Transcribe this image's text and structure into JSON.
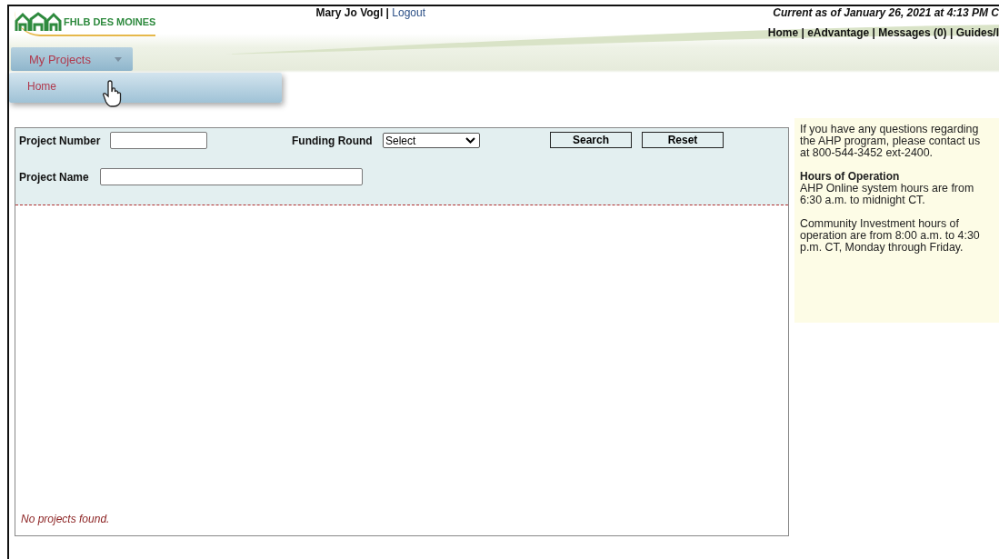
{
  "header": {
    "logo": "FHLB DES MOINES",
    "user": "Mary Jo Vogl",
    "separator": "|",
    "logout": "Logout",
    "current_as_of": "Current as of January 26, 2021 at 4:13 PM C",
    "nav": [
      {
        "label": "Home"
      },
      {
        "label": "eAdvantage"
      },
      {
        "label": "Messages (0)"
      },
      {
        "label": "Guides/I"
      }
    ]
  },
  "menu": {
    "label": "My Projects",
    "expanded": true,
    "items": [
      {
        "label": "Home"
      }
    ]
  },
  "search": {
    "fields": [
      {
        "kind": "text",
        "label": "Project Number"
      },
      {
        "kind": "select",
        "label": "Funding Round",
        "value": "Select"
      },
      {
        "kind": "text",
        "label": "Project Name"
      }
    ],
    "buttons": [
      {
        "label": "Search"
      },
      {
        "label": "Reset"
      }
    ]
  },
  "results": {
    "message": "No projects found."
  },
  "help": {
    "intro": "If you have any questions regarding the AHP program, please contact us at 800-544-3452 ext-2400.",
    "heading": "Hours of Operation",
    "paragraphs": [
      "AHP Online system hours are from 6:30 a.m. to midnight CT.",
      "Community Investment hours of operation are from 8:00 a.m. to 4:30 p.m. CT, Monday through Friday."
    ]
  }
}
